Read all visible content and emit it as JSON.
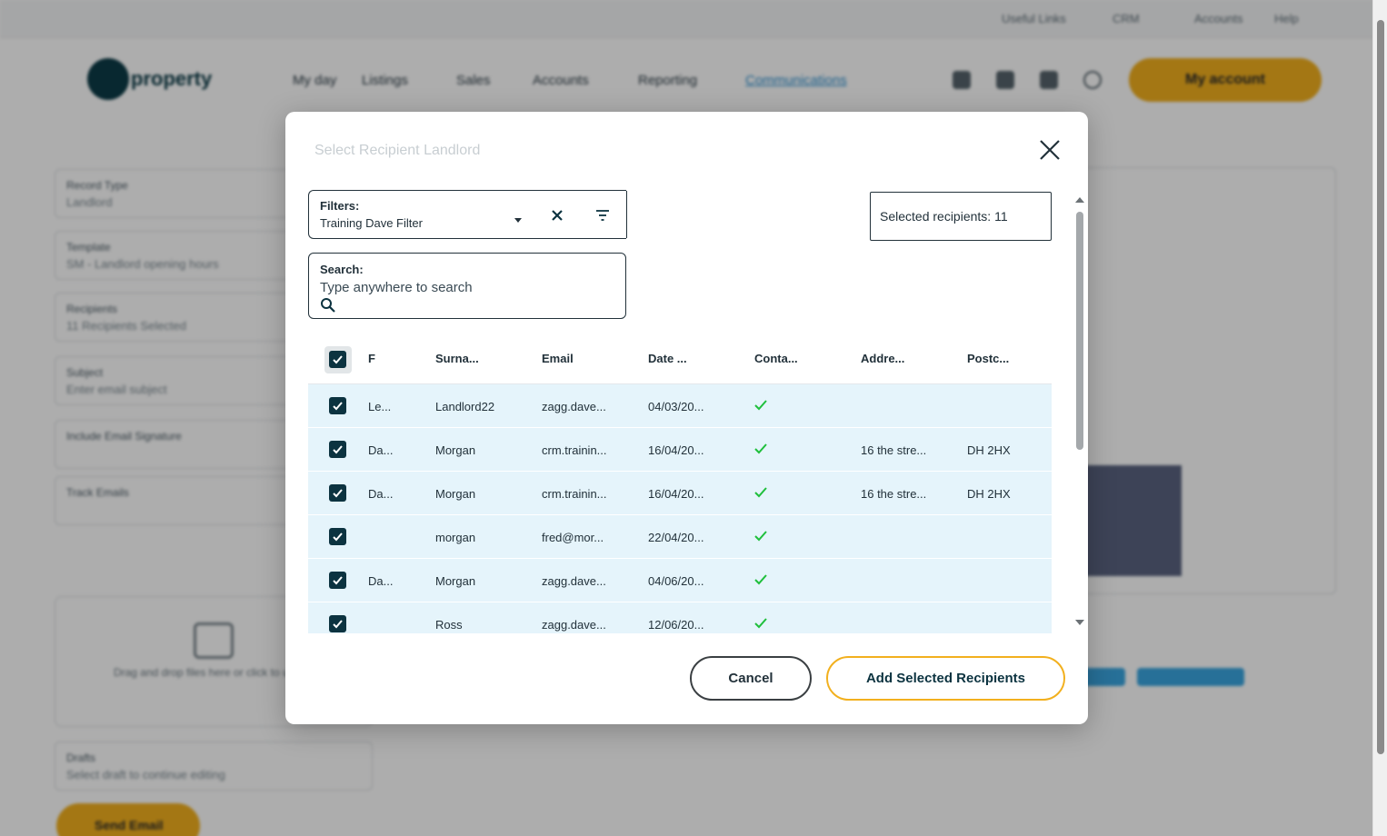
{
  "background": {
    "top_links": [
      "Useful Links",
      "CRM",
      "Accounts",
      "Help"
    ],
    "brand": "property",
    "nav": [
      "My day",
      "Listings",
      "Sales",
      "Accounts",
      "Reporting",
      "Communications"
    ],
    "account_label": "My account",
    "fields": [
      {
        "label": "Record Type",
        "value": "Landlord"
      },
      {
        "label": "Template",
        "value": "SM - Landlord opening hours"
      },
      {
        "label": "Recipients",
        "value": "11 Recipients Selected"
      },
      {
        "label": "Subject",
        "value": "Enter email subject"
      },
      {
        "label": "Include Email Signature",
        "value": ""
      },
      {
        "label": "Track Emails",
        "value": ""
      }
    ],
    "upload_text": "Drag and drop files here or click to upload",
    "drafts_label": "Drafts",
    "drafts_value": "Select draft to continue editing",
    "send_label": "Send Email"
  },
  "modal": {
    "title": "Select Recipient Landlord",
    "filter": {
      "label": "Filters:",
      "value": "Training Dave Filter"
    },
    "selected_text": "Selected recipients: 11",
    "search": {
      "label": "Search:",
      "placeholder": "Type anywhere to search"
    },
    "table": {
      "headers": [
        "F",
        "Surna...",
        "Email",
        "Date ...",
        "Conta...",
        "Addre...",
        "Postc..."
      ],
      "rows": [
        {
          "first": "Le...",
          "surname": "Landlord22",
          "email": "zagg.dave...",
          "date": "04/03/20...",
          "address": "",
          "postcode": ""
        },
        {
          "first": "Da...",
          "surname": "Morgan",
          "email": "crm.trainin...",
          "date": "16/04/20...",
          "address": "16 the stre...",
          "postcode": "DH 2HX"
        },
        {
          "first": "Da...",
          "surname": "Morgan",
          "email": "crm.trainin...",
          "date": "16/04/20...",
          "address": "16 the stre...",
          "postcode": "DH 2HX"
        },
        {
          "first": "",
          "surname": "morgan",
          "email": "fred@mor...",
          "date": "22/04/20...",
          "address": "",
          "postcode": ""
        },
        {
          "first": "Da...",
          "surname": "Morgan",
          "email": "zagg.dave...",
          "date": "04/06/20...",
          "address": "",
          "postcode": ""
        },
        {
          "first": "",
          "surname": "Ross",
          "email": "zagg.dave...",
          "date": "12/06/20...",
          "address": "",
          "postcode": ""
        }
      ]
    },
    "cancel_label": "Cancel",
    "add_label": "Add Selected Recipients"
  },
  "colors": {
    "accent": "#f2b01e",
    "primary": "#0c3340",
    "row_bg": "#e5f4fb",
    "tick": "#1fbf3c"
  },
  "icons": [
    "close-icon",
    "dropdown-caret-icon",
    "clear-x-icon",
    "filter-lines-icon",
    "search-icon",
    "checkbox-checked-icon",
    "tick-icon"
  ]
}
